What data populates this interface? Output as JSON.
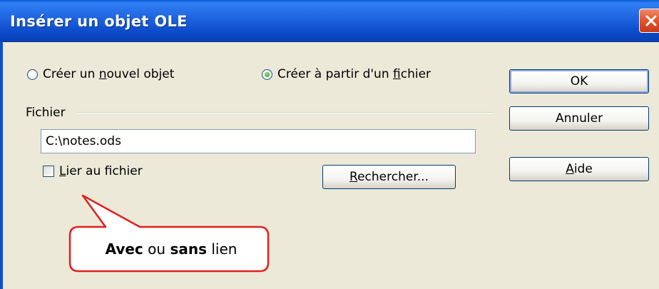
{
  "window": {
    "title": "Insérer un objet OLE"
  },
  "options": {
    "new_object": {
      "pre": "Créer un ",
      "access": "n",
      "post": "ouvel objet",
      "checked": false
    },
    "from_file": {
      "pre": "Créer à partir d'un ",
      "access": "f",
      "post": "ichier",
      "checked": true
    }
  },
  "file_group": {
    "label": "Fichier",
    "path_value": "C:\\notes.ods",
    "link_checkbox": {
      "access": "L",
      "post": "ier au fichier",
      "checked": false
    },
    "browse_button": {
      "access": "R",
      "post": "echercher..."
    }
  },
  "buttons": {
    "ok": "OK",
    "cancel": "Annuler",
    "help": {
      "access": "A",
      "post": "ide"
    }
  },
  "callout": {
    "word1": "Avec",
    "word2": " ou ",
    "word3": "sans",
    "word4": " lien"
  }
}
